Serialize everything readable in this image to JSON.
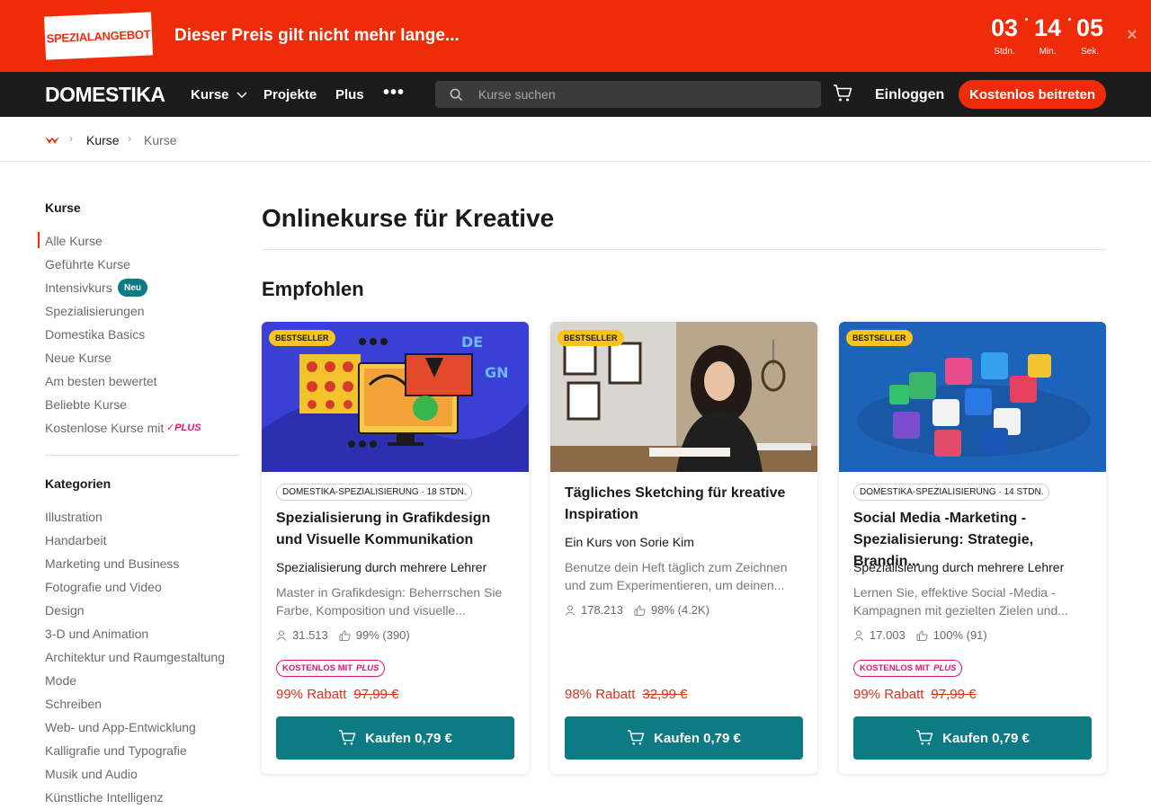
{
  "promo": {
    "badge": "SPEZIALANGEBOT",
    "text": "Dieser Preis gilt nicht mehr lange...",
    "timer": [
      {
        "value": "03",
        "unit": "Stdn."
      },
      {
        "value": "14",
        "unit": "Min."
      },
      {
        "value": "05",
        "unit": "Sek."
      }
    ],
    "close": "×"
  },
  "nav": {
    "logo": "DOMESTIKA",
    "items": [
      "Kurse",
      "Projekte",
      "Plus"
    ],
    "more": "•••",
    "search_placeholder": "Kurse suchen",
    "login": "Einloggen",
    "join": "Kostenlos beitreten"
  },
  "breadcrumb": [
    "Kurse",
    "Kurse"
  ],
  "sidebar": {
    "courses_heading": "Kurse",
    "courses": [
      "Alle Kurse",
      "Geführte Kurse",
      "Intensivkurs",
      "Spezialisierungen",
      "Domestika Basics",
      "Neue Kurse",
      "Am besten bewertet",
      "Beliebte Kurse",
      "Kostenlose Kurse mit"
    ],
    "new_badge": "Neu",
    "plus_mark": "PLUS",
    "categories_heading": "Kategorien",
    "categories": [
      "Illustration",
      "Handarbeit",
      "Marketing und Business",
      "Fotografie und Video",
      "Design",
      "3-D und Animation",
      "Architektur und Raumgestaltung",
      "Mode",
      "Schreiben",
      "Web- und App-Entwicklung",
      "Kalligrafie und Typografie",
      "Musik und Audio",
      "Künstliche Intelligenz"
    ]
  },
  "main": {
    "title": "Onlinekurse für Kreative",
    "section": "Empfohlen",
    "cards": [
      {
        "badge": "BESTSELLER",
        "tag": "DOMESTIKA-SPEZIALISIERUNG · 18 STDN.",
        "title": "Spezialisierung in Grafikdesign und Visuelle Kommunikation",
        "subtitle": "Spezialisierung durch mehrere Lehrer",
        "description": "Master in Grafikdesign: Beherrschen Sie Farbe, Komposition und visuelle...",
        "students": "31.513",
        "rating": "99% (390)",
        "free_plus": "KOSTENLOS MIT",
        "free_plus_mark": "PLUS",
        "discount": "99% Rabatt",
        "old_price": "97,99 €",
        "buy": "Kaufen  0,79 €"
      },
      {
        "badge": "BESTSELLER",
        "tag": "",
        "title": "Tägliches Sketching für kreative Inspiration",
        "subtitle": "Ein Kurs von Sorie Kim",
        "description": "Benutze dein Heft täglich zum Zeichnen und zum Experimentieren, um deinen...",
        "students": "178.213",
        "rating": "98% (4.2K)",
        "free_plus": "",
        "free_plus_mark": "",
        "discount": "98% Rabatt",
        "old_price": "32,99 €",
        "buy": "Kaufen  0,79 €"
      },
      {
        "badge": "BESTSELLER",
        "tag": "DOMESTIKA-SPEZIALISIERUNG · 14 STDN.",
        "title": "Social Media -Marketing - Spezialisierung: Strategie, Brandin...",
        "subtitle": "Spezialisierung durch mehrere Lehrer",
        "description": "Lernen Sie, effektive Social -Media -Kampagnen mit gezielten Zielen und...",
        "students": "17.003",
        "rating": "100% (91)",
        "free_plus": "KOSTENLOS MIT",
        "free_plus_mark": "PLUS",
        "discount": "99% Rabatt",
        "old_price": "97,99 €",
        "buy": "Kaufen  0,79 €"
      }
    ]
  },
  "colors": {
    "brand_red": "#ef2c09",
    "teal": "#0c7b83",
    "plus_pink": "#e0137b",
    "bestseller_yellow": "#f6c518"
  }
}
